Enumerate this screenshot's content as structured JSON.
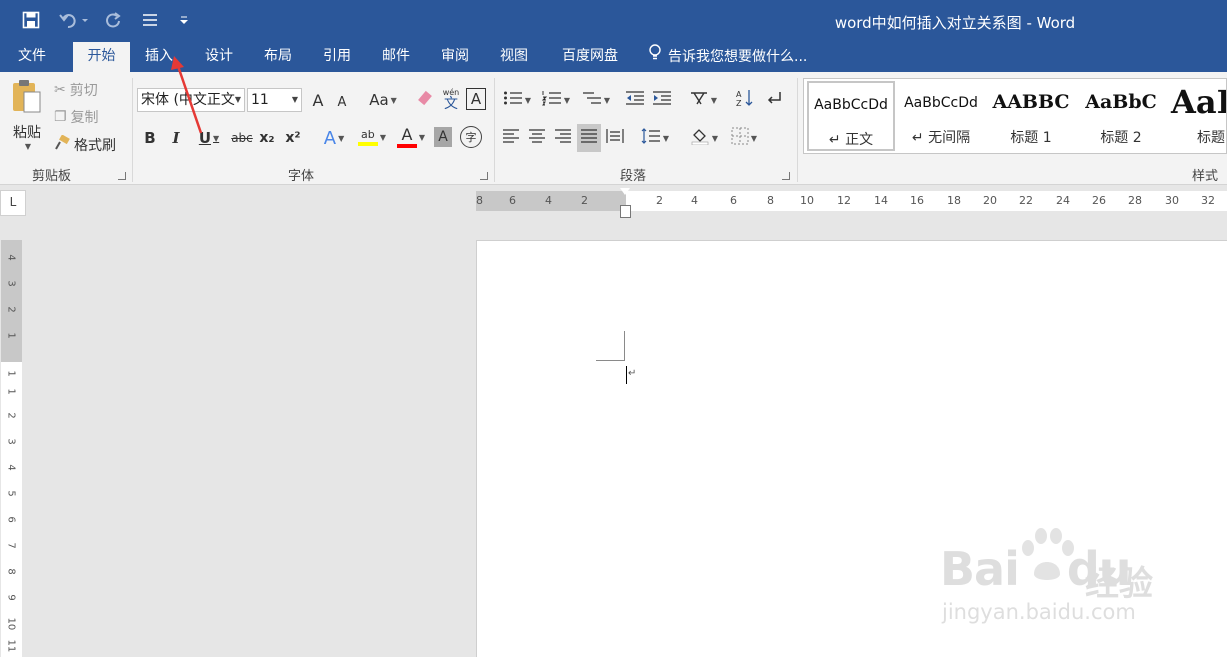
{
  "titlebar": {
    "title": "word中如何插入对立关系图 - Word"
  },
  "tabs": [
    {
      "label": "文件"
    },
    {
      "label": "开始"
    },
    {
      "label": "插入"
    },
    {
      "label": "设计"
    },
    {
      "label": "布局"
    },
    {
      "label": "引用"
    },
    {
      "label": "邮件"
    },
    {
      "label": "审阅"
    },
    {
      "label": "视图"
    },
    {
      "label": "百度网盘"
    }
  ],
  "tellme": {
    "placeholder": "告诉我您想要做什么..."
  },
  "clipboard": {
    "paste": "粘贴",
    "cut": "剪切",
    "copy": "复制",
    "format_painter": "格式刷",
    "group": "剪贴板"
  },
  "font": {
    "name": "宋体 (中文正文",
    "size": "11",
    "grow": "A",
    "shrink": "A",
    "case": "Aa",
    "phonetic": "wén",
    "phonetic_char": "文",
    "border_char": "A",
    "bold": "B",
    "italic": "I",
    "underline": "U",
    "strike": "abc",
    "sub": "x₂",
    "sup": "x²",
    "effects": "A",
    "highlight": "ab",
    "color": "A",
    "shading": "A",
    "enclose": "字",
    "group": "字体"
  },
  "paragraph": {
    "group": "段落"
  },
  "styles": {
    "group": "样式",
    "items": [
      {
        "sample": "AaBbCcDd",
        "name": "↵ 正文"
      },
      {
        "sample": "AaBbCcDd",
        "name": "↵ 无间隔"
      },
      {
        "sample": "AABBC",
        "name": "标题 1"
      },
      {
        "sample": "AaBbC",
        "name": "标题 2"
      },
      {
        "sample": "AaE",
        "name": "标题"
      }
    ]
  },
  "ruler": {
    "corner": "L",
    "h_left": [
      "8",
      "6",
      "4",
      "2"
    ],
    "h_right": [
      "2",
      "4",
      "6",
      "8",
      "10",
      "12",
      "14",
      "16",
      "18",
      "20",
      "22",
      "24",
      "26",
      "28",
      "30",
      "32"
    ],
    "v_top": [
      "4",
      "3",
      "2",
      "1"
    ],
    "v_body": [
      "1",
      "1",
      "2",
      "3",
      "4",
      "5",
      "6",
      "7",
      "8",
      "9",
      "10",
      "11"
    ]
  },
  "document": {
    "paragraph_mark": "↵"
  },
  "watermark": {
    "brand": "Bai",
    "brand2": "du",
    "cn": "经验",
    "url": "jingyan.baidu.com"
  },
  "colors": {
    "accent": "#2b579a",
    "highlight": "#ffff00",
    "font_color": "#ff0000",
    "annotation_arrow": "#e53935"
  }
}
